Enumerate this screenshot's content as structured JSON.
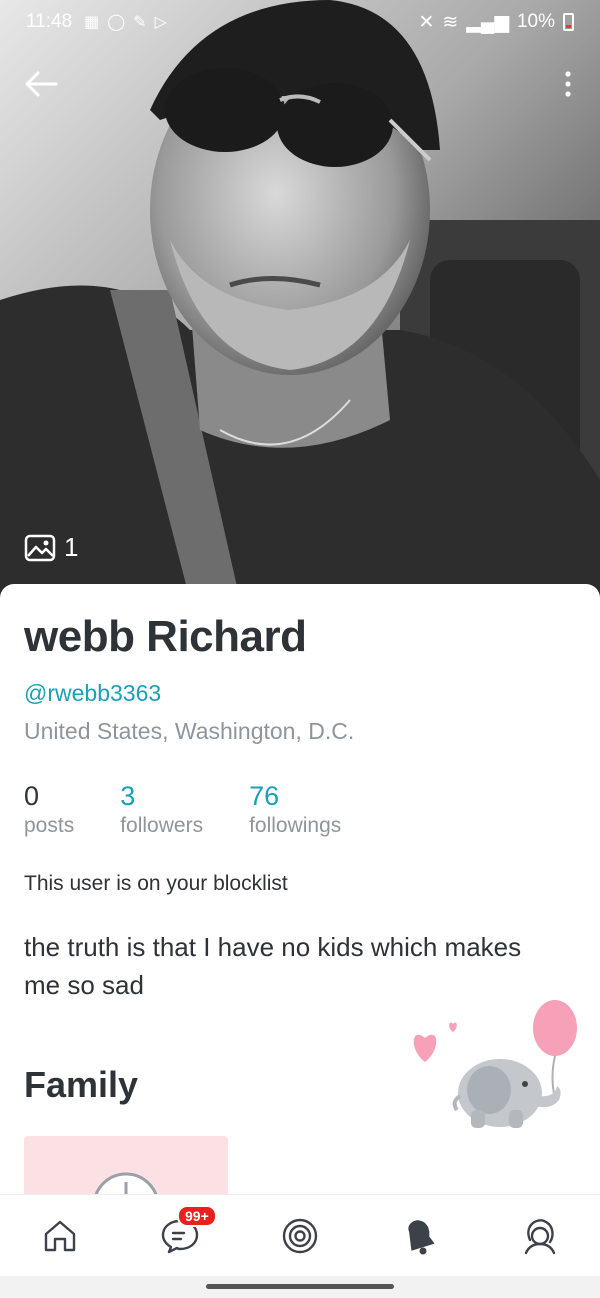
{
  "status_bar": {
    "time": "11:48",
    "battery": "10%"
  },
  "hero": {
    "photo_count": "1"
  },
  "profile": {
    "name": "webb Richard",
    "handle": "@rwebb3363",
    "location": "United States, Washington, D.C.",
    "stats": [
      {
        "value": "0",
        "label": "posts"
      },
      {
        "value": "3",
        "label": "followers"
      },
      {
        "value": "76",
        "label": "followings"
      }
    ],
    "blocklist_notice": "This user is on your blocklist",
    "bio": "the truth is that I have no kids which makes me so sad",
    "section_title": "Family"
  },
  "bottom_nav": {
    "messages_badge": "99+",
    "items": [
      "home-icon",
      "messages-icon",
      "discover-icon",
      "notifications-icon",
      "profile-icon"
    ]
  },
  "colors": {
    "accent": "#1aa0b8",
    "text_dark": "#2e3338",
    "text_muted": "#8e969c",
    "badge": "#e82020",
    "album_bg": "#fbe1e3"
  }
}
